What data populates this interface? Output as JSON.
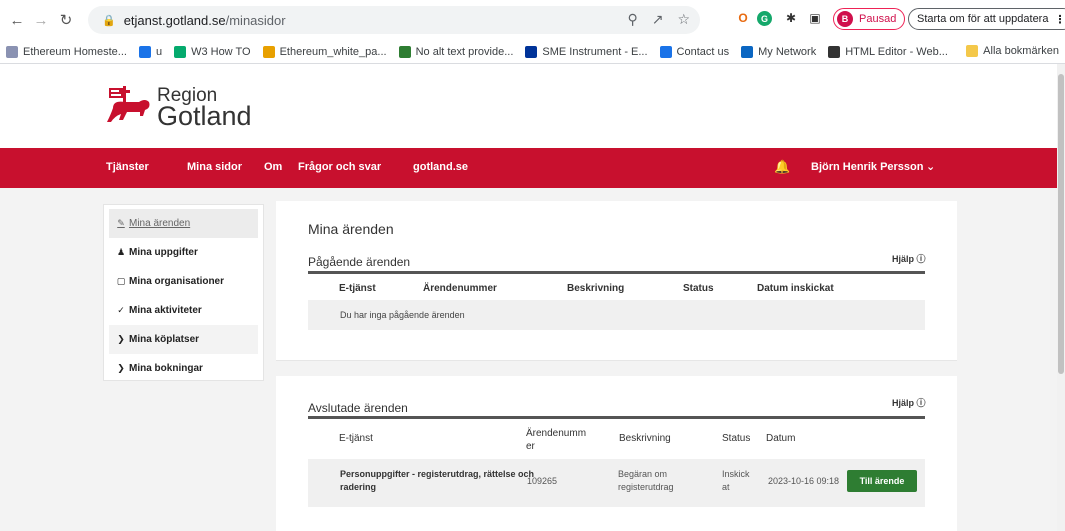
{
  "browser": {
    "url_host": "etjanst.gotland.se",
    "url_path": "/minasidor",
    "profile_initial": "B",
    "profile_status": "Pausad",
    "update_label": "Starta om för att uppdatera",
    "bookmarks": [
      {
        "label": "Ethereum Homeste...",
        "icon": "ethereum-icon",
        "color": "#8a92b2"
      },
      {
        "label": "u",
        "icon": "u-site-icon",
        "color": "#1a73e8"
      },
      {
        "label": "W3 How TO",
        "icon": "w3-icon",
        "color": "#04aa6d"
      },
      {
        "label": "Ethereum_white_pa...",
        "icon": "ethereum-doc-icon",
        "color": "#e8a000"
      },
      {
        "label": "No alt text provide...",
        "icon": "pin-icon",
        "color": "#2e7d32"
      },
      {
        "label": "SME Instrument - E...",
        "icon": "eu-flag-icon",
        "color": "#003399"
      },
      {
        "label": "Contact us",
        "icon": "contact-icon",
        "color": "#1a73e8"
      },
      {
        "label": "My Network",
        "icon": "linkedin-icon",
        "color": "#0a66c2"
      },
      {
        "label": "HTML Editor - Web...",
        "icon": "html-editor-icon",
        "color": "#333333"
      }
    ],
    "bookmarks_more": "»",
    "all_bookmarks": "Alla bokmärken"
  },
  "site": {
    "logo_line1": "Region",
    "logo_line2": "Gotland",
    "brand_color": "#c8102e",
    "nav": [
      "Tjänster",
      "Mina sidor",
      "Om",
      "Frågor och svar",
      "gotland.se"
    ],
    "user_name": "Björn Henrik Persson"
  },
  "sidebar": {
    "items": [
      {
        "label": "Mina ärenden",
        "icon": "pencil-icon"
      },
      {
        "label": "Mina uppgifter",
        "icon": "person-icon"
      },
      {
        "label": "Mina organisationer",
        "icon": "briefcase-icon"
      },
      {
        "label": "Mina aktiviteter",
        "icon": "check-icon"
      },
      {
        "label": "Mina köplatser",
        "icon": "chevron-right-icon"
      },
      {
        "label": "Mina bokningar",
        "icon": "chevron-right-icon"
      }
    ]
  },
  "main": {
    "title": "Mina ärenden",
    "ongoing": {
      "title": "Pågående ärenden",
      "help": "Hjälp",
      "columns": [
        "E-tjänst",
        "Ärendenummer",
        "Beskrivning",
        "Status",
        "Datum inskickat"
      ],
      "empty_text": "Du har inga pågående ärenden"
    },
    "closed": {
      "title": "Avslutade ärenden",
      "help": "Hjälp",
      "columns": [
        "E-tjänst",
        "Ärendenumm er",
        "Beskrivning",
        "Status",
        "Datum"
      ],
      "rows": [
        {
          "service": "Personuppgifter - registerutdrag, rättelse och radering",
          "number": "109265",
          "description": "Begäran om registerutdrag",
          "status": "Inskick at",
          "date": "2023-10-16 09:18",
          "action": "Till ärende"
        }
      ]
    }
  }
}
